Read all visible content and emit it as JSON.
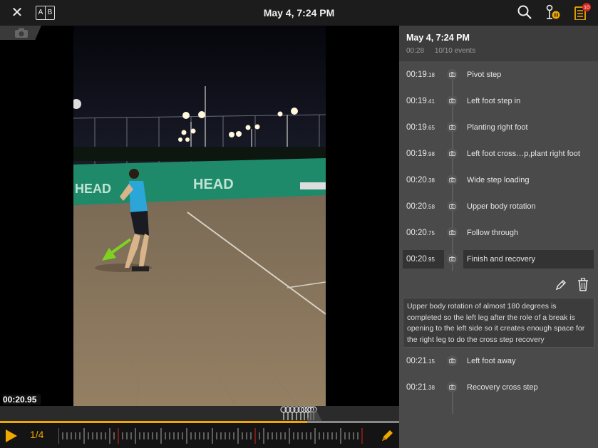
{
  "header": {
    "title": "May 4, 7:24 PM",
    "ab_left": "A",
    "ab_right": "B",
    "badge_count": "10"
  },
  "player": {
    "current_time": "00:20.95",
    "speed": "1/4",
    "progress": 0.77
  },
  "panel": {
    "title": "May 4, 7:24 PM",
    "duration": "00:28",
    "event_count": "10/10 events",
    "events": [
      {
        "time": "00:19",
        "frac": ".18",
        "label": "Pivot step"
      },
      {
        "time": "00:19",
        "frac": ".41",
        "label": "Left foot step in"
      },
      {
        "time": "00:19",
        "frac": ".65",
        "label": "Planting right foot"
      },
      {
        "time": "00:19",
        "frac": ".98",
        "label": "Left foot cross…p,plant right foot"
      },
      {
        "time": "00:20",
        "frac": ".38",
        "label": "Wide step loading"
      },
      {
        "time": "00:20",
        "frac": ".58",
        "label": "Upper body rotation"
      },
      {
        "time": "00:20",
        "frac": ".75",
        "label": "Follow through"
      },
      {
        "time": "00:20",
        "frac": ".95",
        "label": "Finish and recovery"
      },
      {
        "time": "00:21",
        "frac": ".15",
        "label": "Left foot away"
      },
      {
        "time": "00:21",
        "frac": ".38",
        "label": "Recovery cross step"
      }
    ],
    "selected_note": "Upper body rotation of almost 180 degrees is completed so the left leg after the role of a break is opening to the left side so it creates enough space for the right leg to do the cross step recovery"
  },
  "video": {
    "banner_text_1": "HEAD",
    "banner_text_2": "HEAD"
  },
  "colors": {
    "accent": "#f0a800",
    "panel_bg": "#4a4a4a",
    "selected_bg": "#333333",
    "banner_green": "#1f8a6a"
  }
}
